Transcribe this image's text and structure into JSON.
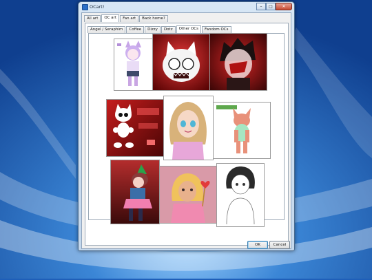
{
  "window": {
    "title": "OCart!"
  },
  "window_buttons": {
    "minimize": "–",
    "maximize": "□",
    "close": "✕"
  },
  "main_tabs": [
    "All art",
    "OC art",
    "Fan art",
    "Back home?"
  ],
  "sub_tabs": [
    "Angel / Seraphim",
    "Coffee",
    "Dizzy",
    "Dotz",
    "Other OCs",
    "Fandom OCs"
  ],
  "images": [
    "Purple-haired catgirl sketch",
    "White cat mask on red",
    "Dark-haired figure with red",
    "Red Dotz sprite sheet",
    "Blonde girl with blue eyes",
    "Green and pink bunny character",
    "Red-haired clown girl",
    "Blonde girl holding heart wand",
    "Dark-haired girl sketch"
  ],
  "buttons": {
    "ok": "OK",
    "cancel": "Cancel"
  },
  "colors": {
    "desktop": "#1f5fb8",
    "accent": "#3c7fb1"
  }
}
